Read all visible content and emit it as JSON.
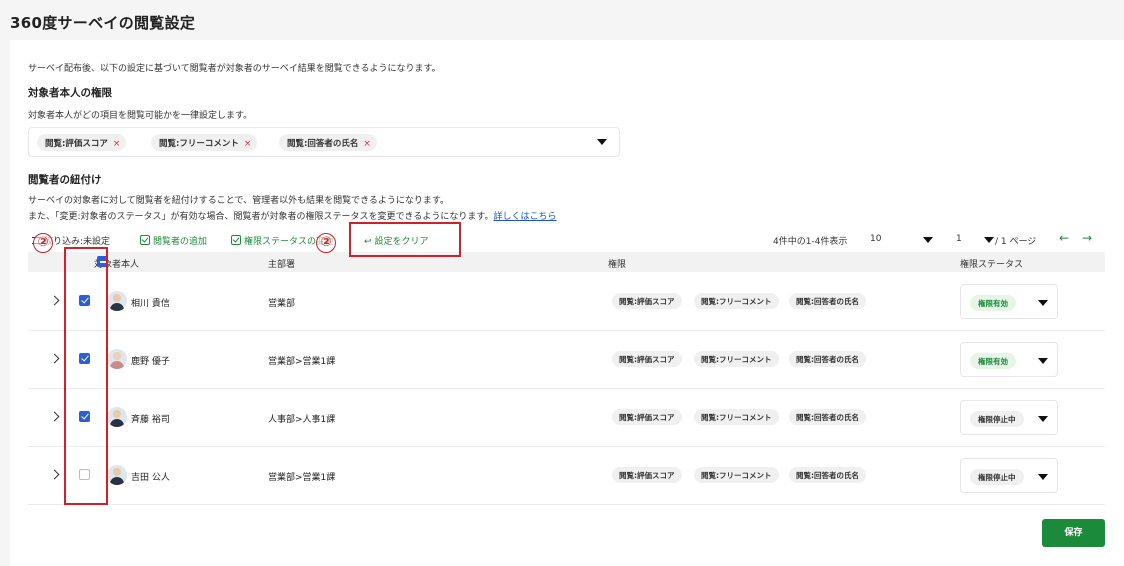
{
  "page_title": "360度サーベイの閲覧設定",
  "intro": "サーベイ配布後、以下の設定に基づいて閲覧者が対象者のサーベイ結果を閲覧できるようになります。",
  "self_section": {
    "title": "対象者本人の権限",
    "description": "対象者本人がどの項目を閲覧可能かを一律設定します。",
    "selected": [
      "閲覧:評価スコア",
      "閲覧:フリーコメント",
      "閲覧:回答者の氏名"
    ],
    "remove_icon": "×"
  },
  "viewer_section": {
    "title": "閲覧者の紐付け",
    "description_1": "サーベイの対象者に対して閲覧者を紐付けすることで、管理者以外も結果を閲覧できるようになります。",
    "description_2": "また、「変更:対象者のステータス」が有効な場合、閲覧者が対象者の権限ステータスを変更できるようになります。",
    "details_link": "詳しくはこちら"
  },
  "toolbar": {
    "filter_label": "絞り込み:未設定",
    "add_viewer_label": "閲覧者の追加",
    "change_status_label": "権限ステータスの変更",
    "clear_label": "設定をクリア",
    "clear_icon": "↩"
  },
  "pagination": {
    "summary": "4件中の1-4件表示",
    "per_page": "10",
    "page": "1",
    "total_pages": "/ 1 ページ",
    "prev_icon": "←",
    "next_icon": "→"
  },
  "table": {
    "headers": [
      "対象者本人",
      "主部署",
      "権限",
      "権限ステータス"
    ],
    "rows": [
      {
        "name": "相川 貴信",
        "department": "営業部",
        "permissions": [
          "閲覧:評価スコア",
          "閲覧:フリーコメント",
          "閲覧:回答者の氏名"
        ],
        "status": "権限有効",
        "checked": true
      },
      {
        "name": "鹿野 優子",
        "department": "営業部>営業1課",
        "permissions": [
          "閲覧:評価スコア",
          "閲覧:フリーコメント",
          "閲覧:回答者の氏名"
        ],
        "status": "権限有効",
        "checked": true
      },
      {
        "name": "斉藤 裕司",
        "department": "人事部>人事1課",
        "permissions": [
          "閲覧:評価スコア",
          "閲覧:フリーコメント",
          "閲覧:回答者の氏名"
        ],
        "status": "権限停止中",
        "checked": true
      },
      {
        "name": "吉田 公人",
        "department": "営業部>営業1課",
        "permissions": [
          "閲覧:評価スコア",
          "閲覧:フリーコメント",
          "閲覧:回答者の氏名"
        ],
        "status": "権限停止中",
        "checked": false
      }
    ]
  },
  "save_label": "保存",
  "annotations": [
    "②",
    "②"
  ],
  "colors": {
    "accent_green": "#1b8a3a",
    "checkbox_blue": "#2b5fd9",
    "annotation_red": "#d0202a",
    "link_blue": "#1a55c8"
  }
}
